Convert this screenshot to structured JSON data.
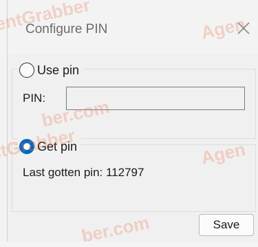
{
  "window": {
    "title": "Configure PIN",
    "close_icon": "close-icon"
  },
  "use_pin": {
    "label": "Use pin",
    "selected": false,
    "pin_label": "PIN:",
    "pin_value": ""
  },
  "get_pin": {
    "label": "Get pin",
    "selected": true,
    "last_pin_text": "Last gotten pin: 112797"
  },
  "actions": {
    "save_label": "Save"
  },
  "watermarks": {
    "w1": "entGrabber",
    "w2": "Agen",
    "w3": "ber.com",
    "w4": "entGrabber",
    "w5": "Agen",
    "w6": "ber.com"
  },
  "colors": {
    "accent": "#0067c0",
    "dialog_bg": "#f0f0f0",
    "title_text": "#6b6b6b"
  }
}
